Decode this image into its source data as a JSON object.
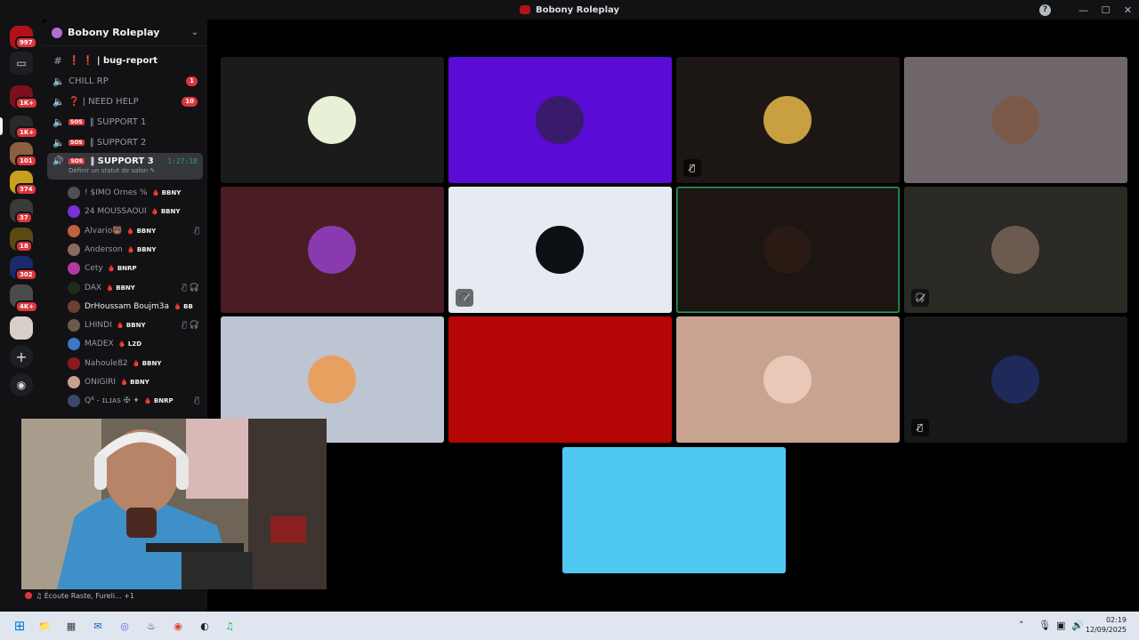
{
  "window": {
    "title": "Bobony Roleplay",
    "controls": {
      "minimize": "—",
      "maximize": "☐",
      "close": "✕"
    },
    "help": "?"
  },
  "rail": {
    "badges": [
      "997",
      "1K+",
      "1K+",
      "101",
      "374",
      "37",
      "18",
      "302",
      "4K+"
    ],
    "add": "+",
    "discover": "◉"
  },
  "server": {
    "name": "Bobony Roleplay"
  },
  "channels": [
    {
      "icon": "#",
      "name": "❗ ❗ | bug-report",
      "bright": true
    },
    {
      "icon": "🔈",
      "name": "CHILL RP",
      "count": "1"
    },
    {
      "icon": "🔈",
      "name": "❓ | NEED HELP",
      "count": "10"
    },
    {
      "icon": "🔈",
      "tag": "SOS",
      "name": "‖ SUPPORT 1"
    },
    {
      "icon": "🔈",
      "tag": "SOS",
      "name": "‖ SUPPORT 2"
    }
  ],
  "active_channel": {
    "icon": "🔊",
    "tag": "SOS",
    "name": "‖ SUPPORT 3",
    "timer": "1:27:18",
    "status": "Définir un statut de salon ✎"
  },
  "members": [
    {
      "name": "! $IMO Ornes %",
      "tag": "🩸 BBNY",
      "color": "#4e5058"
    },
    {
      "name": "24 MOUSSAOUI",
      "tag": "🩸 BBNY",
      "color": "#7b2fd6"
    },
    {
      "name": "Alvario🐻",
      "tag": "🩸 BBNY",
      "icons": "🎙̸",
      "color": "#c0623a"
    },
    {
      "name": "Anderson",
      "tag": "🩸 BBNY",
      "color": "#8a6a60"
    },
    {
      "name": "Cety",
      "tag": "🩸 BNRP",
      "color": "#b03aa0"
    },
    {
      "name": "DAX",
      "tag": "🩸 BBNY",
      "icons": "🎙̸ 🎧̸",
      "color": "#1f2b1f"
    },
    {
      "name": "DrHoussam Boujm3a",
      "tag": "🩸 BB",
      "bright": true,
      "color": "#6a4030"
    },
    {
      "name": "LHINDI",
      "tag": "🩸 BBNY",
      "icons": "🎙̸ 🎧̸",
      "color": "#6a5a4a"
    },
    {
      "name": "MADEX",
      "tag": "🩸 L2D",
      "color": "#3a78c8"
    },
    {
      "name": "Nahoule82",
      "tag": "🩸 BBNY",
      "color": "#8a1a1a"
    },
    {
      "name": "ONIGIRI",
      "tag": "🩸 BBNY",
      "color": "#c9a090"
    },
    {
      "name": "Q⁸ - ɪʟɪᴀs ✠ ✦",
      "tag": "🩸 BNRP",
      "icons": "🎙̸",
      "color": "#3a4a6a"
    }
  ],
  "tiles": [
    {
      "bg": "#1b1b1b",
      "av": "#e9f0d8",
      "mute": ""
    },
    {
      "bg": "#5b0bd6",
      "av": "#3a1a6a",
      "mute": ""
    },
    {
      "bg": "#1c1714",
      "av": "#c8a040",
      "mute": "🎙̸"
    },
    {
      "bg": "#6f666b",
      "av": "#7c5a4a",
      "mute": ""
    },
    {
      "bg": "#4a1c24",
      "av": "#8a3ab0",
      "mute": ""
    },
    {
      "bg": "#e6ebf2",
      "av": "#0c0f14",
      "mute": "🎧̸"
    },
    {
      "bg": "#1c1511",
      "av": "#2a1a14",
      "mute": "",
      "speaking": true
    },
    {
      "bg": "#2b2924",
      "av": "#6a5a50",
      "mute": "🎧̸"
    },
    {
      "bg": "#bdc4d2",
      "av": "#e8a060",
      "mute": ""
    },
    {
      "bg": "#b50505",
      "av": "#b50505",
      "mute": ""
    },
    {
      "bg": "#c7a390",
      "av": "#eac8b8",
      "mute": ""
    },
    {
      "bg": "#18181b",
      "av": "#1d2a5a",
      "mute": "🎙̸"
    },
    {
      "bg": "#4fc8f2",
      "av": "#4fc8f2",
      "mute": ""
    }
  ],
  "now_playing": {
    "text": "♫ Écoute Raste, Fureli... +1"
  },
  "taskbar": {
    "clock_time": "02:19",
    "clock_date": "12/09/2025",
    "tray": "˄",
    "apps": [
      "⊞",
      "📁",
      "▦",
      "✉",
      "◎",
      "♨",
      "◉",
      "◐",
      "♫"
    ]
  }
}
